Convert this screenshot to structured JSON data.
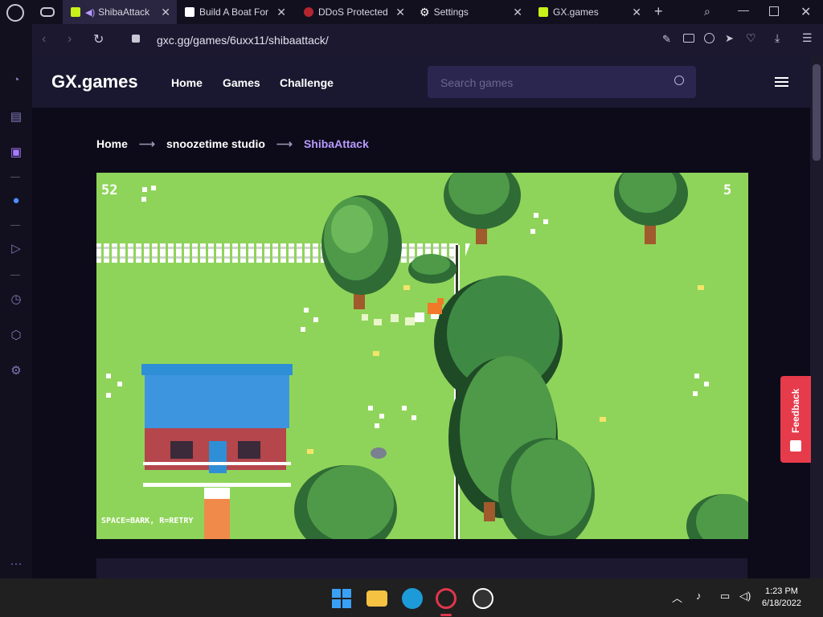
{
  "tabs": [
    {
      "label": "ShibaAttack",
      "active": true
    },
    {
      "label": "Build A Boat For",
      "active": false
    },
    {
      "label": "DDoS Protected",
      "active": false
    },
    {
      "label": "Settings",
      "active": false
    },
    {
      "label": "GX.games",
      "active": false
    }
  ],
  "address": {
    "url": "gxc.gg/games/6uxx11/shibaattack/"
  },
  "site": {
    "logo": "GX.games",
    "nav": [
      "Home",
      "Games",
      "Challenge"
    ],
    "search_placeholder": "Search games",
    "breadcrumb": [
      "Home",
      "snoozetime studio",
      "ShibaAttack"
    ]
  },
  "game": {
    "score_left": "52",
    "score_right": "5",
    "controls_hint": "SPACE=BARK, R=RETRY"
  },
  "feedback": {
    "label": "Feedback"
  },
  "taskbar": {
    "time": "1:23 PM",
    "date": "6/18/2022"
  },
  "colors": {
    "accent": "#b79bff",
    "grass": "#8fd45a",
    "feedback": "#e63b4b"
  }
}
